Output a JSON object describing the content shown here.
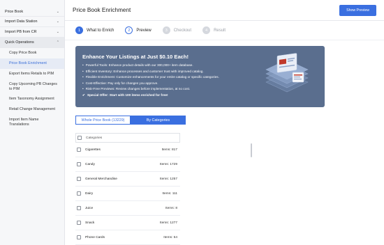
{
  "sidebar": {
    "items": [
      {
        "label": "Price Book",
        "chevron": "⌄"
      },
      {
        "label": "Import Data Station",
        "chevron": "⌄"
      },
      {
        "label": "Import PB from CR",
        "chevron": "⌄"
      },
      {
        "label": "Quick Operations",
        "chevron": "⌃"
      }
    ],
    "sub_items": [
      {
        "label": "Copy Price Book"
      },
      {
        "label": "Price Book Enrichment"
      },
      {
        "label": "Export Items Retails to PIM"
      },
      {
        "label": "Copy Upcoming PB Changes to PIM"
      },
      {
        "label": "Item Taxonomy Assignment"
      },
      {
        "label": "Retail Change Management"
      },
      {
        "label": "Import Item Name Translations"
      }
    ]
  },
  "header": {
    "title": "Price Book Enrichment",
    "action_label": "Show Preview"
  },
  "steps": [
    {
      "num": "1",
      "label": "What to Enrich"
    },
    {
      "num": "2",
      "label": "Preview"
    },
    {
      "num": "3",
      "label": "Checkout"
    },
    {
      "num": "4",
      "label": "Result"
    }
  ],
  "banner": {
    "title": "Enhance Your Listings at Just $0.10 Each!",
    "bullets": [
      "Powerful Tools: Enhance product details with our 300,000+ item database.",
      "Efficient Inventory: Enhance processes and customer trust with improved catalog.",
      "Flexible Enrichment: Customize enhancements for your entire catalog or specific categories.",
      "Cost-Effective: Pay only for changes you approve.",
      "Risk-Free Previews: Review changes before implementation, at no cost."
    ],
    "bullet_mark": "•",
    "special_mark": "✔",
    "special": "Special Offer: Start with 100 items enriched for free!"
  },
  "toggle": {
    "option_1": "Whole Price Book (13229)",
    "option_2": "By Categories",
    "selected": "By Categories"
  },
  "categories": {
    "header": "Categories",
    "rows": [
      {
        "name": "Cigarettes",
        "items": "Items: 817"
      },
      {
        "name": "Candy",
        "items": "Items: 1729"
      },
      {
        "name": "General Merchandise",
        "items": "Items: 1257"
      },
      {
        "name": "Dairy",
        "items": "Items: 111"
      },
      {
        "name": "Juice",
        "items": "Items: 8"
      },
      {
        "name": "Snack",
        "items": "Items: 1277"
      },
      {
        "name": "Phone Cards",
        "items": "Items: 54"
      }
    ]
  },
  "colors": {
    "primary": "#3a6fe0",
    "banner_bg": "#5a6e8e",
    "active_nav_bg": "#e6ebf5"
  }
}
